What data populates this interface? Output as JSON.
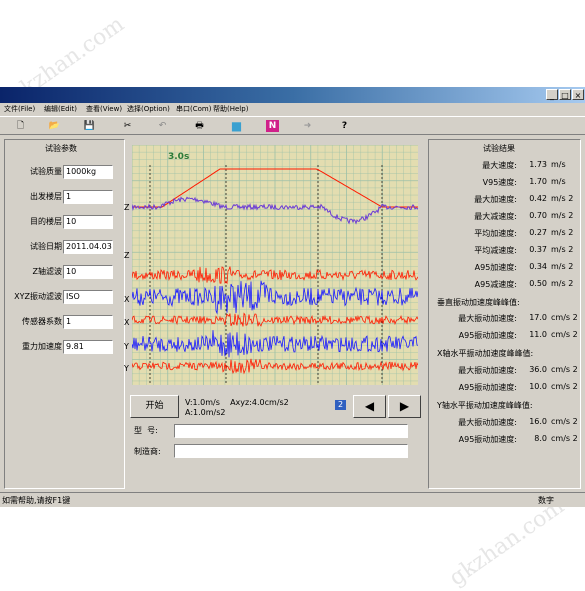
{
  "watermark": "gkzhan.com",
  "window": {
    "title": "",
    "buttons": {
      "minimize": "_",
      "maximize": "□",
      "close": "×"
    }
  },
  "menu": [
    {
      "label": "文件(File)"
    },
    {
      "label": "编辑(Edit)"
    },
    {
      "label": "查看(View)"
    },
    {
      "label": "选择(Option)"
    },
    {
      "label": "串口(Com)"
    },
    {
      "label": "帮助(Help)"
    }
  ],
  "toolbar": {
    "new_icon": "new-file-icon",
    "open_icon": "open-folder-icon",
    "save_icon": "save-disk-icon",
    "cut_icon": "scissors-icon",
    "undo_icon": "undo-icon",
    "print_icon": "printer-icon",
    "blue_icon": "blue-square-icon",
    "n_icon": "n-letter-icon",
    "arrow_icon": "arrow-right-icon",
    "help_icon": "question-icon",
    "glyphs": {
      "new": "🗋",
      "open": "📂",
      "save": "💾",
      "cut": "✂",
      "undo": "↶",
      "print": "🖶",
      "blue": "■",
      "n": "N",
      "arrow": "➜",
      "help": "?"
    }
  },
  "params": {
    "title": "试验参数",
    "fields": [
      {
        "label": "试验质量",
        "value": "1000kg"
      },
      {
        "label": "出发楼层",
        "value": "1"
      },
      {
        "label": "目的楼层",
        "value": "10"
      },
      {
        "label": "试验日期",
        "value": "2011.04.03"
      },
      {
        "label": "Z轴滤波",
        "value": "10"
      },
      {
        "label": "XYZ振动滤波",
        "value": "ISO"
      },
      {
        "label": "传感器系数",
        "value": "1"
      },
      {
        "label": "重力加速度",
        "value": "9.81"
      }
    ]
  },
  "chart": {
    "time_label": "3.0s",
    "channel_labels": [
      "Z",
      "Z",
      "X",
      "X",
      "Y",
      "Y"
    ],
    "colors": {
      "grid_bg": "#e3ddb0",
      "grid_line": "#9cc0a8",
      "red": "#ff1a00",
      "blue": "#1a1aff",
      "purple": "#6a3bd6"
    }
  },
  "controls": {
    "start_label": "开始",
    "info_line1": "V:1.0m/s    Axyz:4.0cm/s2",
    "info_line2": "A:1.0m/s2",
    "page_value": "2",
    "prev_glyph": "◀",
    "next_glyph": "▶",
    "model_label": "型  号:",
    "model_value": "",
    "maker_label": "制造商:",
    "maker_value": ""
  },
  "results": {
    "title": "试验结果",
    "rows": [
      {
        "label": "最大速度:",
        "value": "1.73",
        "unit": "m/s"
      },
      {
        "label": "V95速度:",
        "value": "1.70",
        "unit": "m/s"
      },
      {
        "label": "最大加速度:",
        "value": "0.42",
        "unit": "m/s 2"
      },
      {
        "label": "最大减速度:",
        "value": "0.70",
        "unit": "m/s 2"
      },
      {
        "label": "平均加速度:",
        "value": "0.27",
        "unit": "m/s 2"
      },
      {
        "label": "平均减速度:",
        "value": "0.37",
        "unit": "m/s 2"
      },
      {
        "label": "A95加速度:",
        "value": "0.34",
        "unit": "m/s 2"
      },
      {
        "label": "A95减速度:",
        "value": "0.50",
        "unit": "m/s 2"
      }
    ],
    "section1": "垂直振动加速度峰峰值:",
    "section1_rows": [
      {
        "label": "最大振动加速度:",
        "value": "17.0",
        "unit": "cm/s 2"
      },
      {
        "label": "A95振动加速度:",
        "value": "11.0",
        "unit": "cm/s 2"
      }
    ],
    "section2": "X轴水平振动加速度峰峰值:",
    "section2_rows": [
      {
        "label": "最大振动加速度:",
        "value": "36.0",
        "unit": "cm/s 2"
      },
      {
        "label": "A95振动加速度:",
        "value": "10.0",
        "unit": "cm/s 2"
      }
    ],
    "section3": "Y轴水平振动加速度峰峰值:",
    "section3_rows": [
      {
        "label": "最大振动加速度:",
        "value": "16.0",
        "unit": "cm/s 2"
      },
      {
        "label": "A95振动加速度:",
        "value": "8.0",
        "unit": "cm/s 2"
      }
    ]
  },
  "status": {
    "help_text": "如需帮助,请按F1键",
    "mode_text": "数字"
  }
}
